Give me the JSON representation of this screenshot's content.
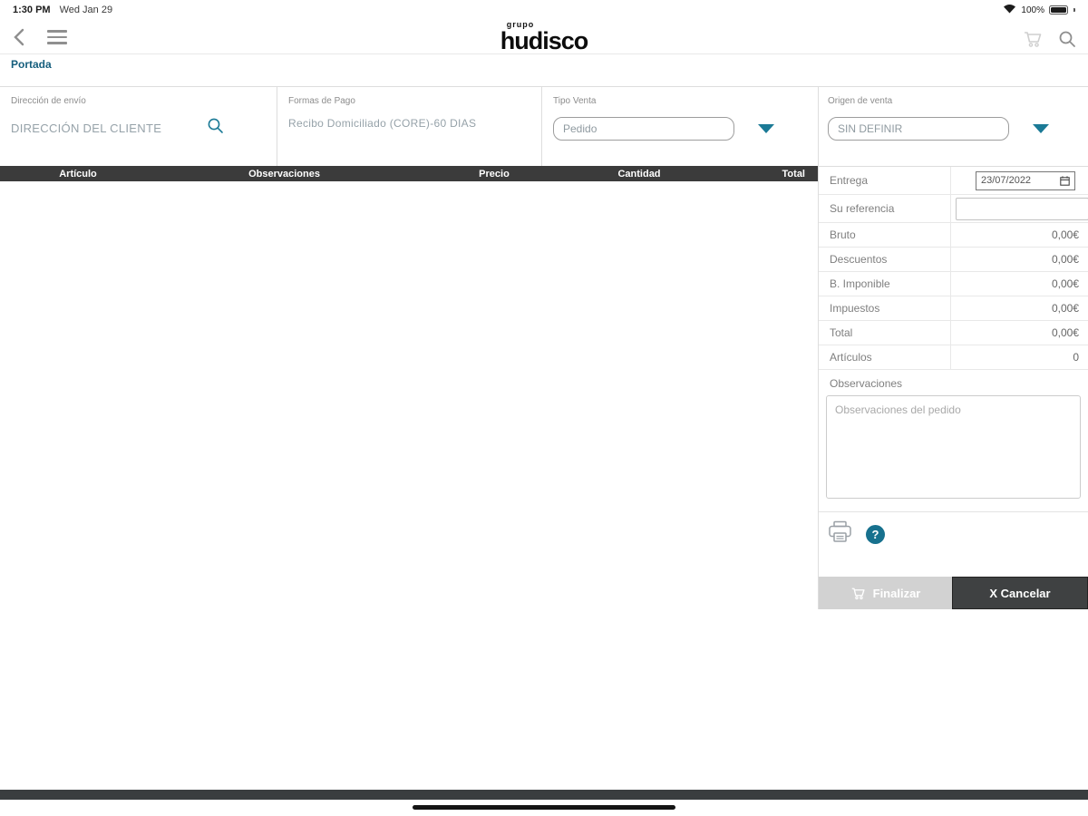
{
  "status_bar": {
    "time": "1:30 PM",
    "date": "Wed Jan 29",
    "battery": "100%"
  },
  "header": {
    "logo_small": "grupo",
    "logo_main": "hudisco"
  },
  "breadcrumb": {
    "label": "Portada"
  },
  "fields": {
    "shipping": {
      "label": "Dirección de envío",
      "value": "DIRECCIÓN DEL CLIENTE"
    },
    "payment": {
      "label": "Formas de Pago",
      "value": "Recibo Domiciliado (CORE)-60 DIAS"
    },
    "sale_type": {
      "label": "Tipo Venta",
      "value": "Pedido"
    },
    "sale_origin": {
      "label": "Origen de venta",
      "value": "SIN DEFINIR"
    }
  },
  "table": {
    "headers": [
      "Artículo",
      "Observaciones",
      "Precio",
      "Cantidad",
      "Total"
    ],
    "rows": []
  },
  "summary": {
    "entrega": {
      "label": "Entrega",
      "value": "23/07/2022"
    },
    "referencia": {
      "label": "Su referencia",
      "value": ""
    },
    "bruto": {
      "label": "Bruto",
      "value": "0,00€"
    },
    "descuentos": {
      "label": "Descuentos",
      "value": "0,00€"
    },
    "imponible": {
      "label": "B. Imponible",
      "value": "0,00€"
    },
    "impuestos": {
      "label": "Impuestos",
      "value": "0,00€"
    },
    "total": {
      "label": "Total",
      "value": "0,00€"
    },
    "articulos": {
      "label": "Artículos",
      "value": "0"
    },
    "observaciones": {
      "label": "Observaciones",
      "placeholder": "Observaciones del pedido",
      "value": ""
    }
  },
  "buttons": {
    "finalizar": "Finalizar",
    "cancelar": "X Cancelar"
  },
  "icons": {
    "help_glyph": "?"
  },
  "colors": {
    "accent_teal": "#1b7a96",
    "breadcrumb_teal": "#155e7d",
    "table_header_bg": "#3b3b3b",
    "cancel_button_bg": "#3f4142",
    "finalize_button_bg": "#d2d2d2"
  }
}
